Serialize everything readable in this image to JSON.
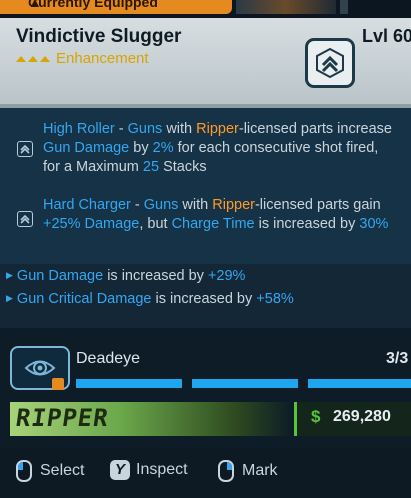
{
  "top_tab": {
    "label": "Currently Equipped"
  },
  "item": {
    "name": "Vindictive Slugger",
    "rarity": "Enhancement",
    "level": "Lvl 60",
    "rarity_color": "#d9a400"
  },
  "perks": [
    {
      "icon": "chevron-up-icon",
      "segments": [
        {
          "text": "High Roller",
          "color": "blue"
        },
        {
          "text": " - ",
          "color": "plain"
        },
        {
          "text": "Guns",
          "color": "blue"
        },
        {
          "text": " with ",
          "color": "plain"
        },
        {
          "text": "Ripper",
          "color": "orange"
        },
        {
          "text": "-licensed parts increase ",
          "color": "plain"
        },
        {
          "text": "Gun Damage",
          "color": "blue"
        },
        {
          "text": " by ",
          "color": "plain"
        },
        {
          "text": "2%",
          "color": "blue"
        },
        {
          "text": " for each consecutive shot fired, for a Maximum ",
          "color": "plain"
        },
        {
          "text": "25",
          "color": "blue"
        },
        {
          "text": " Stacks",
          "color": "plain"
        }
      ]
    },
    {
      "icon": "chevron-up-icon",
      "segments": [
        {
          "text": "Hard Charger",
          "color": "blue"
        },
        {
          "text": " - ",
          "color": "plain"
        },
        {
          "text": "Guns",
          "color": "blue"
        },
        {
          "text": " with ",
          "color": "plain"
        },
        {
          "text": "Ripper",
          "color": "orange"
        },
        {
          "text": "-licensed parts gain ",
          "color": "plain"
        },
        {
          "text": "+25% Damage",
          "color": "blue"
        },
        {
          "text": ", but ",
          "color": "plain"
        },
        {
          "text": "Charge Time",
          "color": "blue"
        },
        {
          "text": " is increased by ",
          "color": "plain"
        },
        {
          "text": "30%",
          "color": "blue"
        }
      ]
    }
  ],
  "bonuses": [
    {
      "stat": "Gun Damage",
      "text": " is increased by ",
      "value": "+29%"
    },
    {
      "stat": "Gun Critical Damage",
      "text": " is increased by ",
      "value": "+58%"
    }
  ],
  "manufacturer": {
    "icon": "eye-target-icon",
    "name": "Deadeye",
    "count": "3/3",
    "progress_filled": 3,
    "progress_total": 3
  },
  "brand": {
    "logo_text": "RIPPER"
  },
  "price": {
    "currency_symbol": "$",
    "value": "269,280"
  },
  "actions": [
    {
      "key": "left-mouse-icon",
      "label": "Select"
    },
    {
      "key": "Y",
      "label": "Inspect"
    },
    {
      "key": "right-mouse-icon",
      "label": "Mark"
    }
  ],
  "colors": {
    "accent_blue": "#34a7f0",
    "accent_orange": "#ff9a2a",
    "price_green": "#57c23a",
    "equipped_orange": "#e58a1e"
  }
}
